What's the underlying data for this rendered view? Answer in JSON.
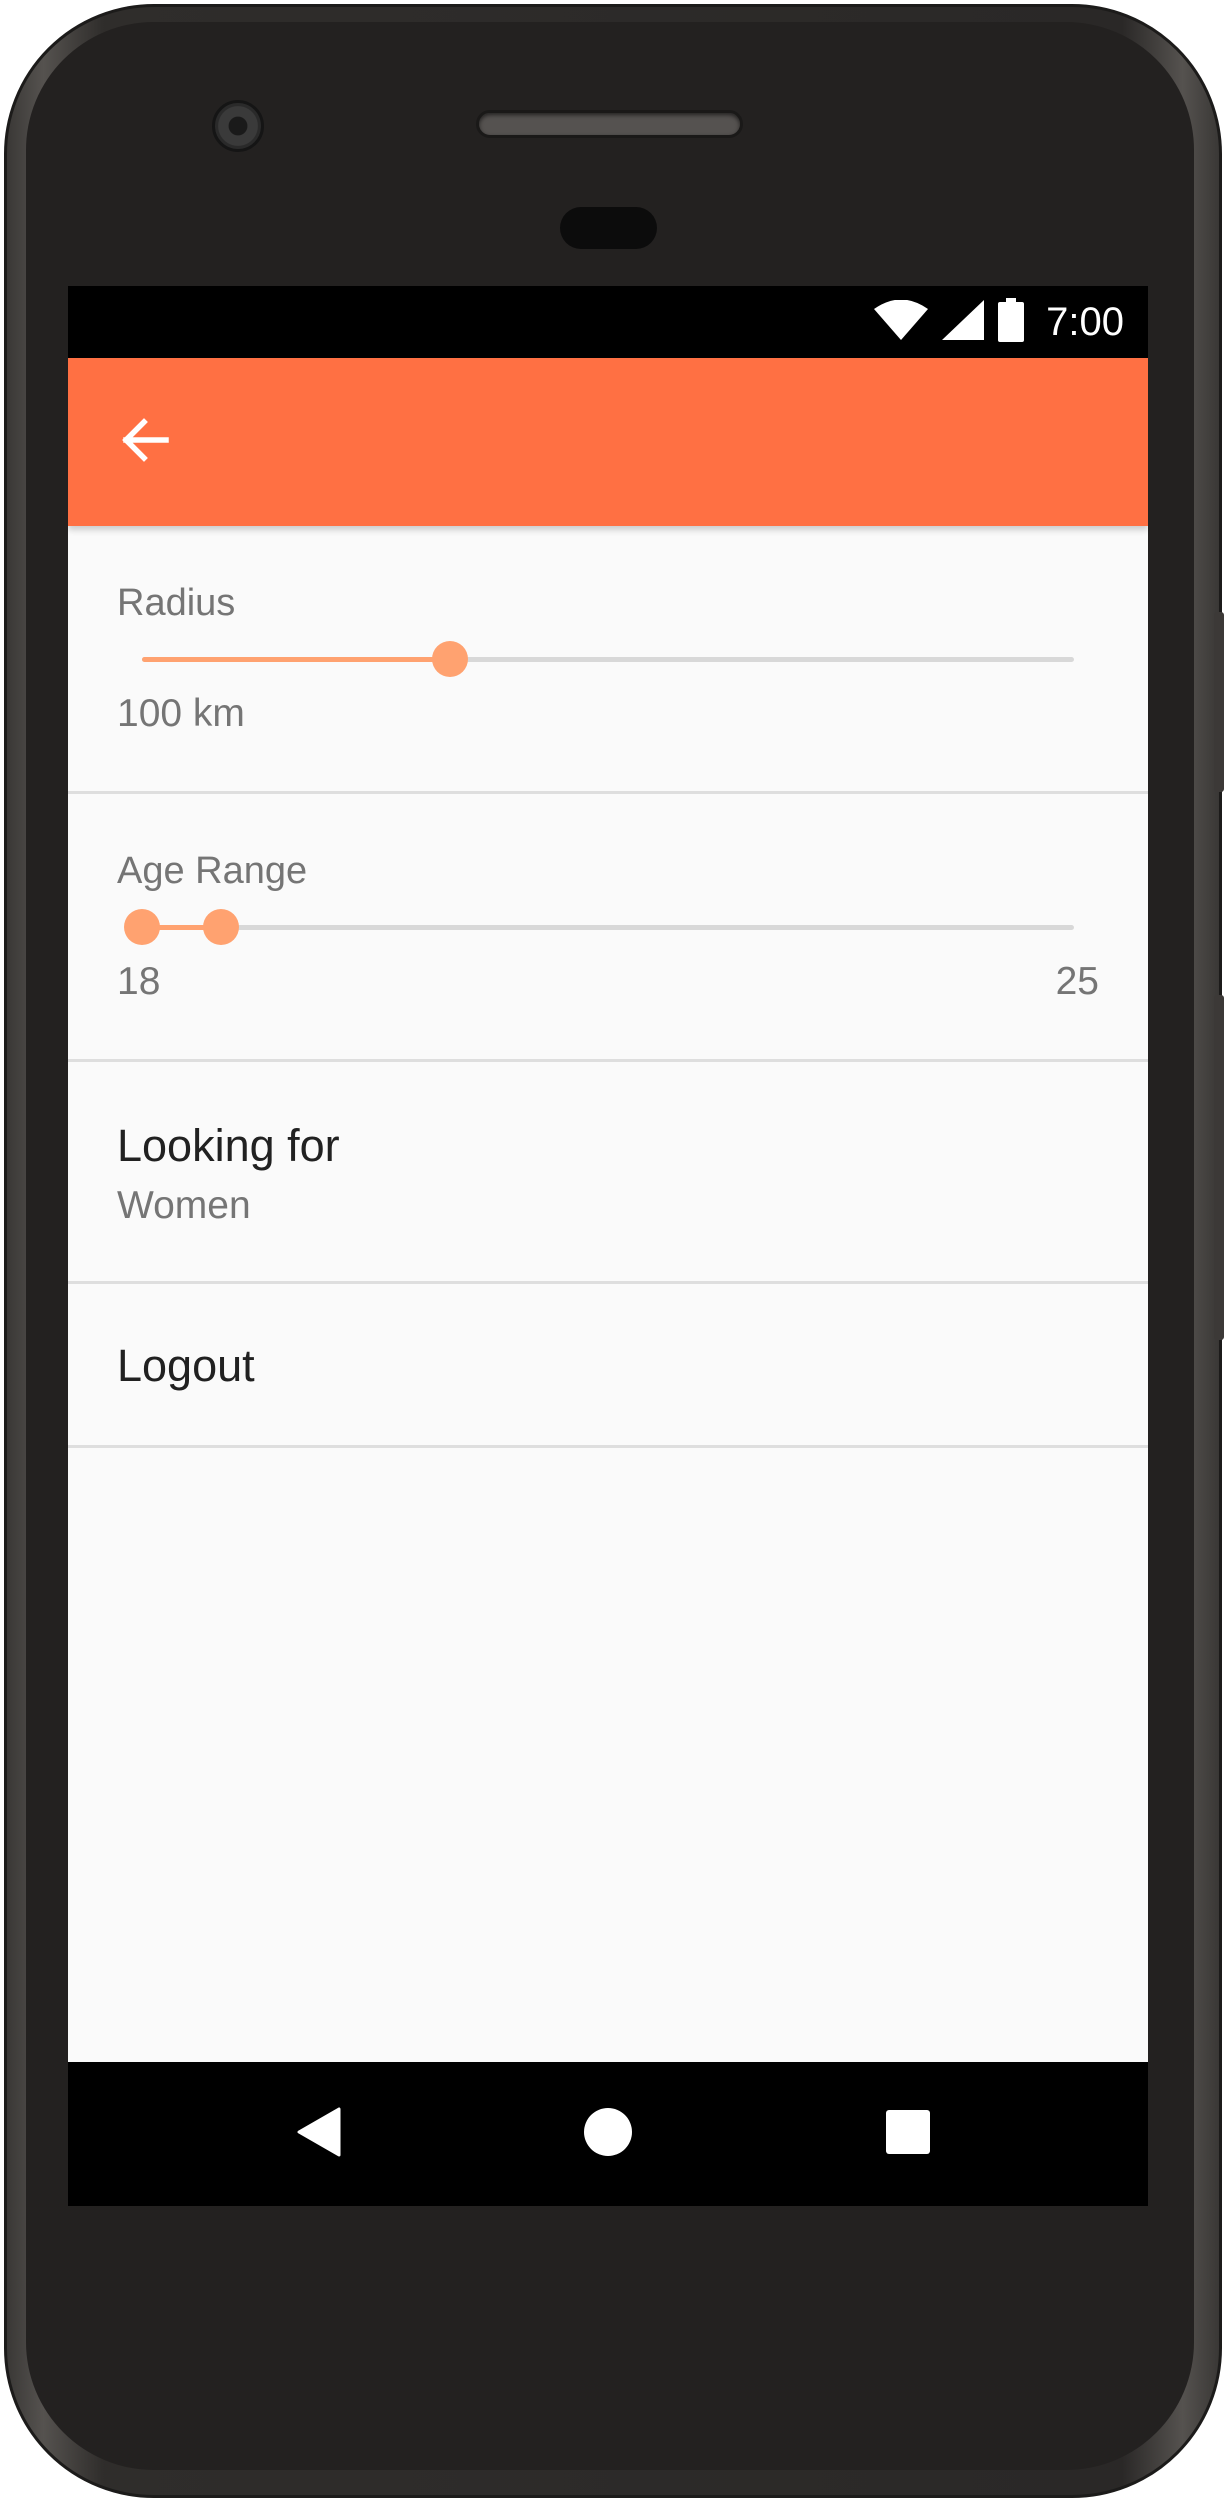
{
  "status_bar": {
    "time": "7:00",
    "icons": [
      "wifi-icon",
      "cell-signal-icon",
      "battery-icon"
    ]
  },
  "app_bar": {
    "color": "#ff7043",
    "back_icon": "arrow-back-icon"
  },
  "settings": {
    "radius": {
      "label": "Radius",
      "value_text": "100 km",
      "slider_fraction": 0.33
    },
    "age_range": {
      "label": "Age Range",
      "min_label": "18",
      "max_label": "25",
      "low_fraction": 0.0,
      "high_fraction": 0.085
    },
    "looking_for": {
      "title": "Looking for",
      "value": "Women"
    },
    "logout": {
      "label": "Logout"
    }
  },
  "accent_color": "#ffa270",
  "nav_bar": {
    "buttons": [
      "back-triangle-icon",
      "home-circle-icon",
      "recents-square-icon"
    ]
  }
}
